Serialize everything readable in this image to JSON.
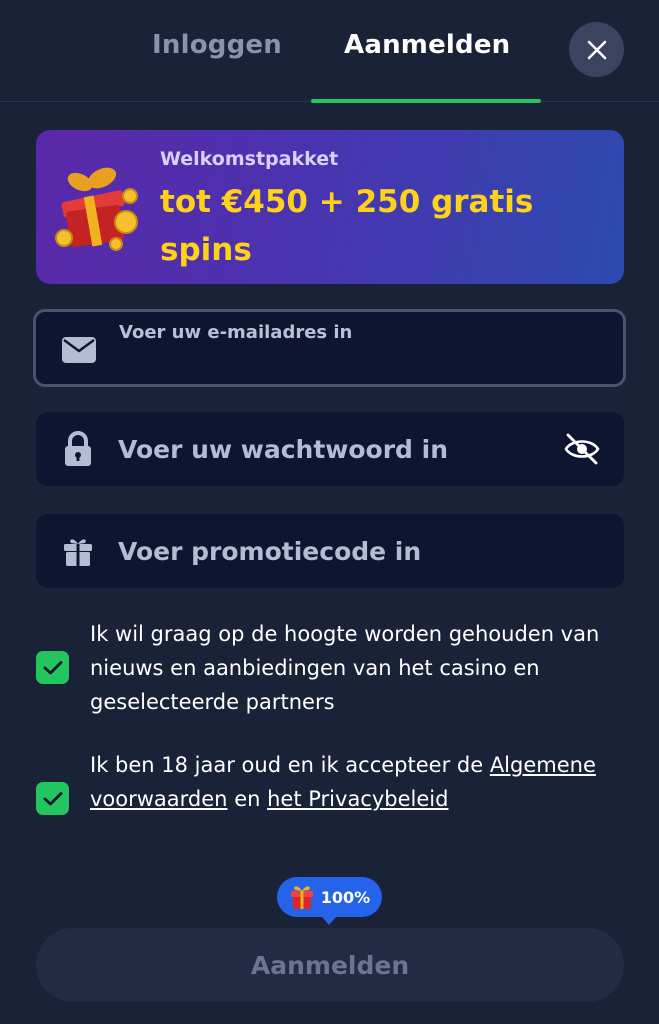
{
  "tabs": {
    "login": "Inloggen",
    "register": "Aanmelden",
    "active": "register"
  },
  "banner": {
    "subtitle": "Welkomstpakket",
    "title": "tot €450 + 250 gratis spins"
  },
  "email": {
    "label": "Voer uw e-mailadres in",
    "value": ""
  },
  "password": {
    "placeholder": "Voer uw wachtwoord in",
    "value": ""
  },
  "promo": {
    "placeholder": "Voer promotiecode in",
    "value": ""
  },
  "consent": {
    "news": {
      "checked": true,
      "text": "Ik wil graag op de hoogte worden gehouden van nieuws en aanbiedingen van het casino en geselecteerde partners"
    },
    "terms": {
      "checked": true,
      "prefix": "Ik ben 18 jaar oud en ik accepteer de",
      "terms_link": "Algemene voorwaarden",
      "middle": "en",
      "privacy_link": "het Privacybeleid"
    }
  },
  "progress": {
    "label": "100%",
    "value": 100
  },
  "submit": {
    "label": "Aanmelden",
    "enabled": false
  },
  "icons": {
    "close": "close-icon",
    "gift_art": "gift-box-coins-icon",
    "email": "envelope-icon",
    "password": "lock-icon",
    "eye": "eye-off-icon",
    "promo": "gift-icon",
    "check": "check-icon",
    "progress": "gift-icon"
  },
  "colors": {
    "background": "#1a2238",
    "accent": "#22c55e",
    "banner_text": "#ffd21a",
    "badge": "#2563eb"
  }
}
